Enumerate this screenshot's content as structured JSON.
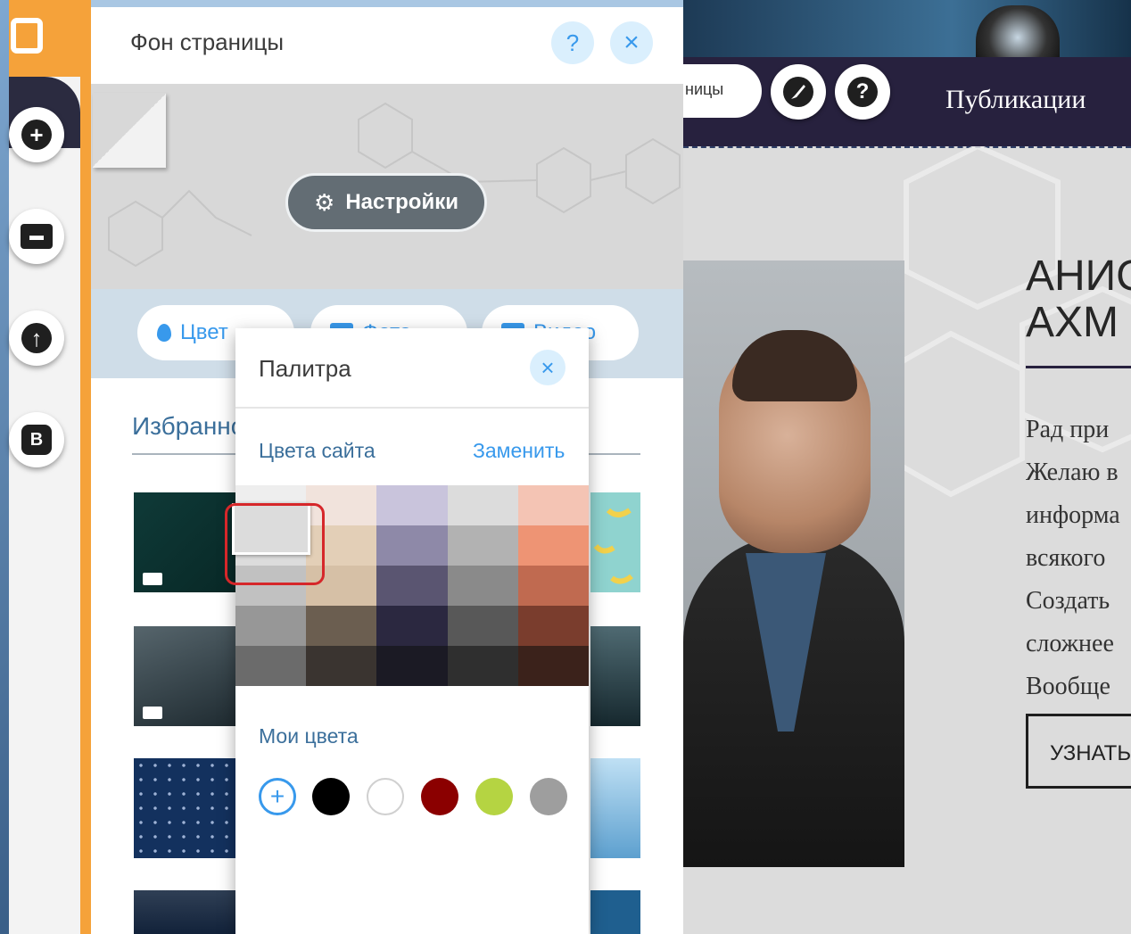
{
  "panel": {
    "title": "Фон страницы",
    "help_glyph": "?",
    "close_glyph": "×",
    "settings_label": "Настройки",
    "tabs": [
      {
        "label": "Цвет",
        "icon": "drop-icon"
      },
      {
        "label": "Фото",
        "icon": "image-icon"
      },
      {
        "label": "Видео",
        "icon": "video-icon"
      }
    ],
    "favorites_title": "Избранное"
  },
  "palette": {
    "title": "Палитра",
    "close_glyph": "×",
    "site_colors_label": "Цвета сайта",
    "replace_label": "Заменить",
    "swatches": [
      [
        "#eeeeee",
        "#f1e3dc",
        "#c9c4dc",
        "#dcdcdc",
        "#f4c4b4"
      ],
      [
        "#dcdcdc",
        "#e3cfb7",
        "#8e89a8",
        "#b2b2b2",
        "#ee9474"
      ],
      [
        "#c1c1c1",
        "#d6c0a6",
        "#5a5571",
        "#8a8a8a",
        "#c06a50"
      ],
      [
        "#979797",
        "#6b5e50",
        "#2b2840",
        "#585858",
        "#7a3d2d"
      ],
      [
        "#6b6b6b",
        "#3a3430",
        "#1b1a24",
        "#2f2f2f",
        "#3b221b"
      ]
    ],
    "selected_color": "#dcdcdc",
    "my_colors_label": "Мои цвета",
    "add_glyph": "+",
    "my_colors": [
      "#000000",
      "#ffffff",
      "#8b0000",
      "#b5d442",
      "#9e9e9e"
    ]
  },
  "toolbar": {
    "add_glyph": "+",
    "store_glyph": "▬",
    "upload_glyph": "↑",
    "blog_glyph": "B"
  },
  "site": {
    "pages_pill": "ницы",
    "help_glyph": "?",
    "nav_publications": "Публикации",
    "heading": "АНИС\nАХМ",
    "body_text": "Рад при\nЖелаю в\nинформа\nвсякого\nСоздать\nсложнее\nВообще",
    "learn_button": "УЗНАТЬ"
  },
  "colors": {
    "accent": "#3899ec",
    "orange": "#f5a23a",
    "nav_dark": "#27213e",
    "selection_red": "#d6272a"
  }
}
